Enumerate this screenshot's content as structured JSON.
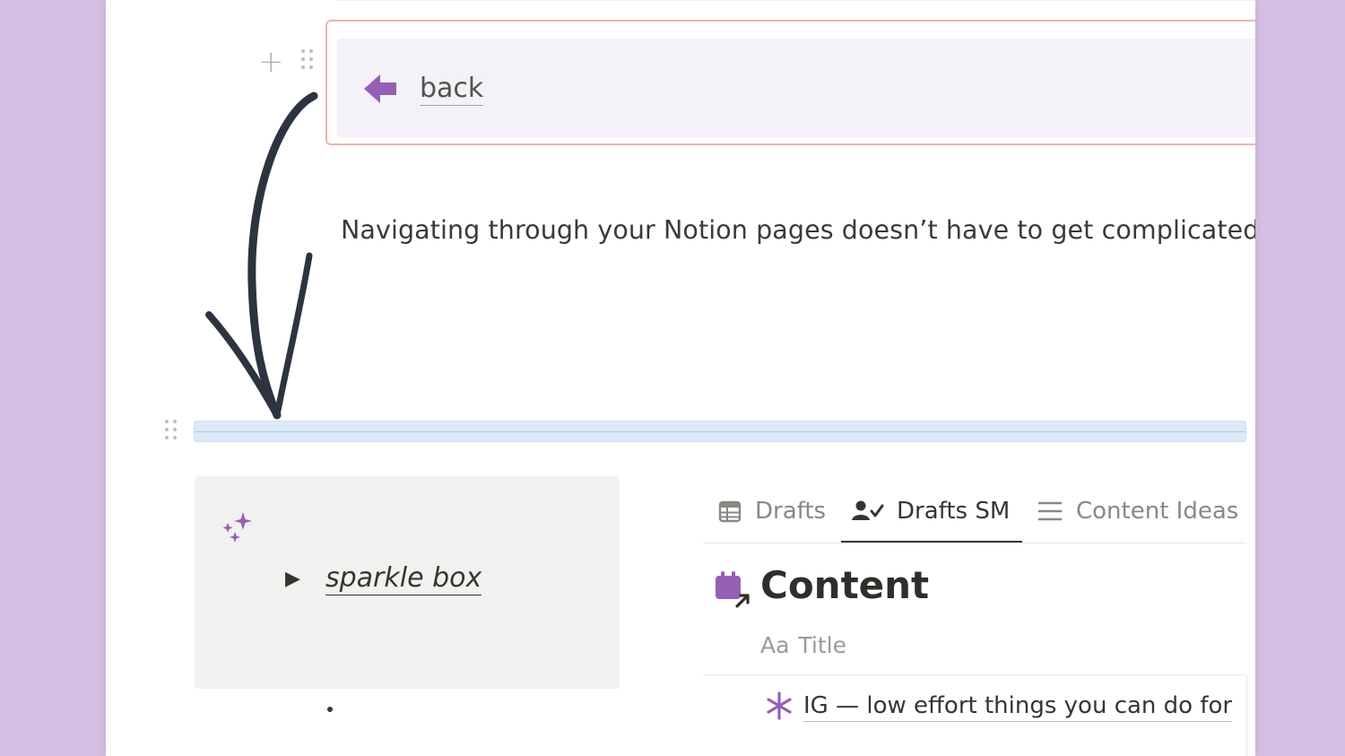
{
  "callout": {
    "link_text": "back"
  },
  "body_text": "Navigating through your Notion pages doesn’t have to get complicated",
  "toggle": {
    "label": "sparkle box"
  },
  "database": {
    "tabs": [
      {
        "label": "Drafts",
        "icon": "table-icon"
      },
      {
        "label": "Drafts SM",
        "icon": "person-check-icon",
        "active": true
      },
      {
        "label": "Content Ideas",
        "icon": "list-icon"
      }
    ],
    "title": "Content",
    "title_icon": "calendar-link-icon",
    "property_header": {
      "icon_text": "Aa",
      "label": "Title"
    },
    "rows": [
      {
        "icon": "asterisk-icon",
        "title": "IG — low effort things you can do for"
      }
    ]
  },
  "colors": {
    "background": "#d5c0e3",
    "accent_purple": "#9560b4",
    "callout_border": "#f0b3ad",
    "callout_bg": "#f4f1f8",
    "divider_highlight": "#dbe9f8",
    "toggle_bg": "#f1f1ef"
  }
}
